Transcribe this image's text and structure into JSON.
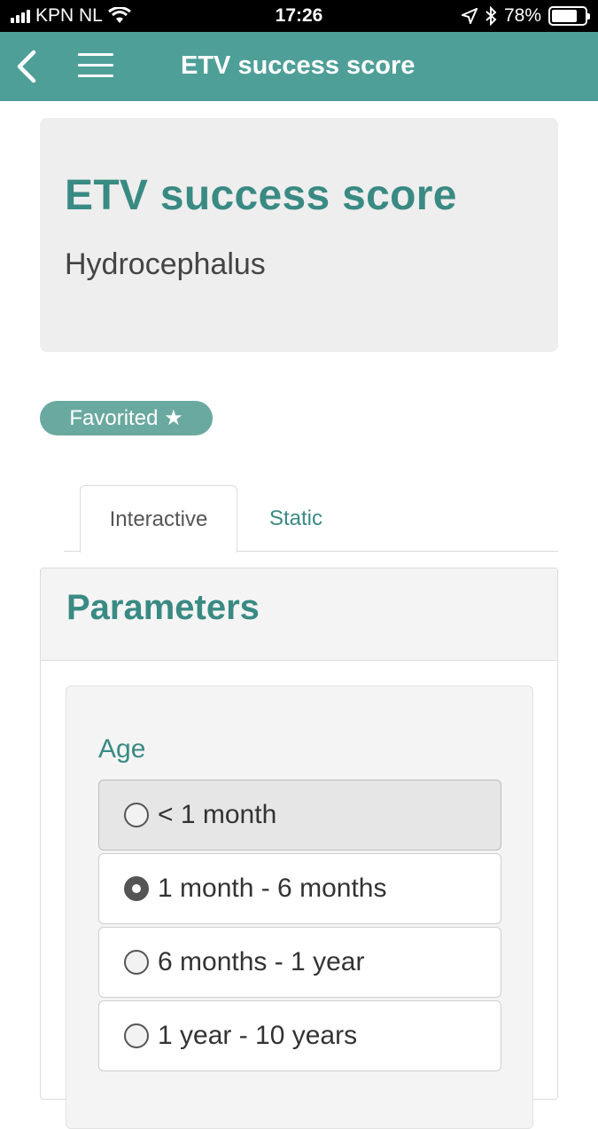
{
  "status_bar": {
    "carrier": "KPN NL",
    "time": "17:26",
    "battery_percent": "78%",
    "battery_level": 0.78
  },
  "app_bar": {
    "title": "ETV success score"
  },
  "hero": {
    "title": "ETV success score",
    "subtitle": "Hydrocephalus"
  },
  "favorite_badge": {
    "label": "Favorited ★"
  },
  "tabs": [
    {
      "label": "Interactive",
      "active": true
    },
    {
      "label": "Static",
      "active": false
    }
  ],
  "parameters": {
    "title": "Parameters",
    "age": {
      "label": "Age",
      "options": [
        {
          "label": "< 1 month",
          "selected": false
        },
        {
          "label": "1 month - 6 months",
          "selected": true
        },
        {
          "label": "6 months - 1 year",
          "selected": false
        },
        {
          "label": "1 year - 10 years",
          "selected": false
        }
      ]
    }
  },
  "colors": {
    "accent": "#4e9f98",
    "accent_text": "#3a8a84",
    "badge": "#6aa9a0"
  }
}
